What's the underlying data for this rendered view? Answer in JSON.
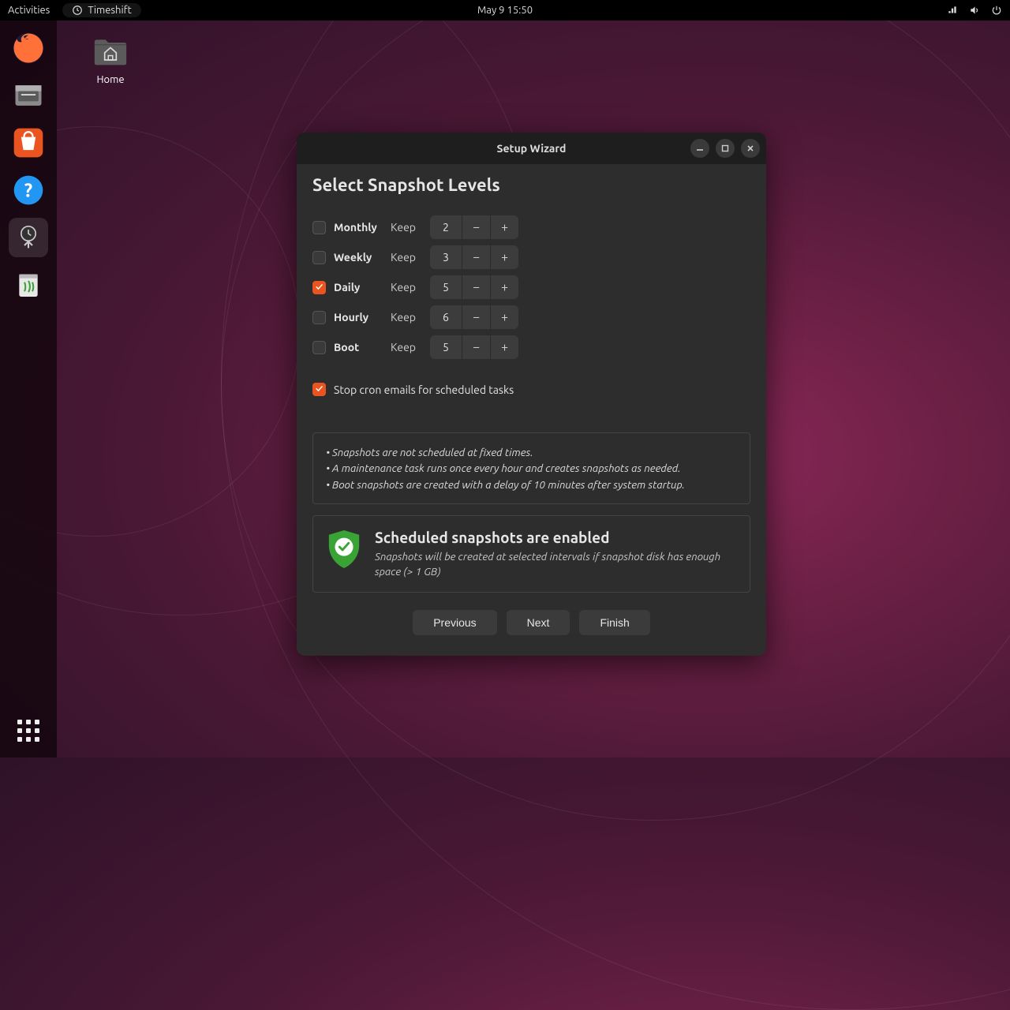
{
  "topbar": {
    "activities": "Activities",
    "app_name": "Timeshift",
    "clock": "May 9  15:50"
  },
  "desktop": {
    "home_label": "Home"
  },
  "window": {
    "title": "Setup Wizard",
    "heading": "Select Snapshot Levels",
    "keep_label": "Keep",
    "levels": [
      {
        "name": "Monthly",
        "checked": false,
        "keep": "2"
      },
      {
        "name": "Weekly",
        "checked": false,
        "keep": "3"
      },
      {
        "name": "Daily",
        "checked": true,
        "keep": "5"
      },
      {
        "name": "Hourly",
        "checked": false,
        "keep": "6"
      },
      {
        "name": "Boot",
        "checked": false,
        "keep": "5"
      }
    ],
    "cron_checked": true,
    "cron_label": "Stop cron emails for scheduled tasks",
    "info": [
      "Snapshots are not scheduled at fixed times.",
      "A maintenance task runs once every hour and creates snapshots as needed.",
      "Boot snapshots are created with a delay of 10 minutes after system startup."
    ],
    "status_title": "Scheduled snapshots are enabled",
    "status_body": "Snapshots will be created at selected intervals if snapshot disk has enough space (> 1 GB)",
    "buttons": {
      "previous": "Previous",
      "next": "Next",
      "finish": "Finish"
    }
  }
}
